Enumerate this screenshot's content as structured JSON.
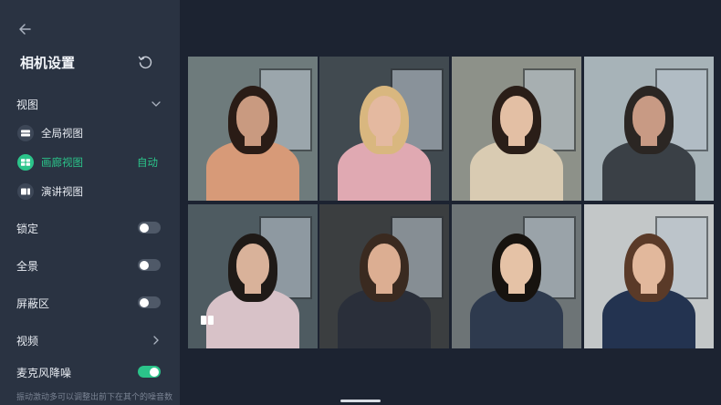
{
  "header": {
    "title": "相机设置"
  },
  "sections": {
    "view": "视图",
    "lock": "锁定",
    "panorama": "全景",
    "mask": "屏蔽区",
    "video": "视频",
    "noise": "麦克风降噪"
  },
  "view_options": [
    {
      "label": "全局视图",
      "icon": "global-view-icon",
      "active": false
    },
    {
      "label": "画廊视图",
      "icon": "gallery-view-icon",
      "active": true,
      "badge": "自动"
    },
    {
      "label": "演讲视图",
      "icon": "speaker-view-icon",
      "active": false
    }
  ],
  "toggles": {
    "lock": false,
    "panorama": false,
    "mask": false,
    "noise": true
  },
  "hint": "振动激动多可以调整出前下在其个的噪音数",
  "colors": {
    "accent": "#2bc48a",
    "sidebar": "#2a3342",
    "background": "#1b2230"
  },
  "video_tiles": [
    {
      "id": "tile-1",
      "hair": "#2a1c16",
      "skin": "#c99a80",
      "shirt": "#d79a78",
      "bg": "#6e7b7c"
    },
    {
      "id": "tile-2",
      "hair": "#d9b77f",
      "skin": "#e4b9a0",
      "shirt": "#e0a9b2",
      "bg": "#414a50"
    },
    {
      "id": "tile-3",
      "hair": "#2a1e18",
      "skin": "#e3bfa4",
      "shirt": "#d9cbb2",
      "bg": "#8d9189"
    },
    {
      "id": "tile-4",
      "hair": "#2b2623",
      "skin": "#c89a84",
      "shirt": "#3a4046",
      "bg": "#a7b3b8"
    },
    {
      "id": "tile-5",
      "hair": "#1f1a17",
      "skin": "#d9b29a",
      "shirt": "#d8c2c8",
      "bg": "#4e5b61"
    },
    {
      "id": "tile-6",
      "hair": "#3a2a20",
      "skin": "#dcae92",
      "shirt": "#2a2f3a",
      "bg": "#3b3e40"
    },
    {
      "id": "tile-7",
      "hair": "#17130f",
      "skin": "#e5c2a6",
      "shirt": "#2e3a4e",
      "bg": "#6d7476"
    },
    {
      "id": "tile-8",
      "hair": "#5a3a28",
      "skin": "#e2b89c",
      "shirt": "#233350",
      "bg": "#c3c7c8"
    }
  ]
}
